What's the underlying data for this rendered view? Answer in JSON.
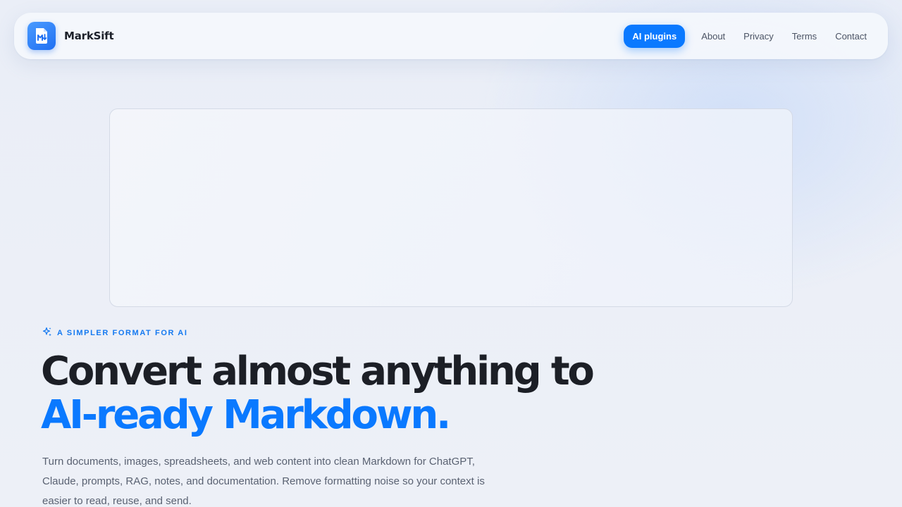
{
  "brand": {
    "name": "MarkSift",
    "logo_icon": "markdown-file-icon"
  },
  "nav": {
    "items": [
      {
        "label": "AI plugins",
        "active": true
      },
      {
        "label": "About"
      },
      {
        "label": "Privacy"
      },
      {
        "label": "Terms"
      },
      {
        "label": "Contact"
      }
    ]
  },
  "hero": {
    "eyebrow": "A SIMPLER FORMAT FOR AI",
    "eyebrow_icon": "sparkle-icon",
    "headline_line1": "Convert almost anything to",
    "headline_line2": "AI-ready Markdown.",
    "description": "Turn documents, images, spreadsheets, and web content into clean Markdown for ChatGPT, Claude, prompts, RAG, notes, and documentation. Remove formatting noise so your context is easier to read, reuse, and send."
  },
  "colors": {
    "accent": "#0a79ff",
    "background": "#edf0f7",
    "text": "#1c1f26",
    "muted": "#5a6272"
  }
}
